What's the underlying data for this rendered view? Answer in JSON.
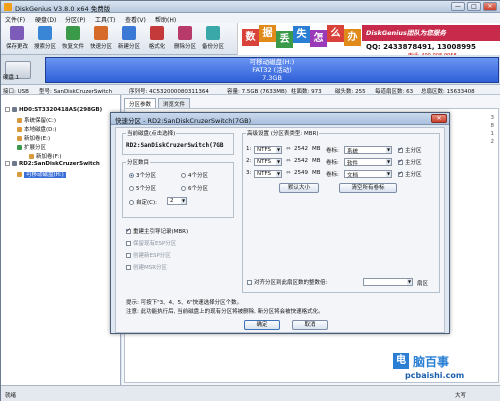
{
  "window": {
    "title": "DiskGenius V3.8.0 x64 免费版",
    "buttons": [
      "—",
      "□",
      "✕"
    ]
  },
  "menu": [
    "文件(F)",
    "硬盘(D)",
    "分区(P)",
    "工具(T)",
    "查看(V)",
    "帮助(H)"
  ],
  "toolbar": [
    {
      "label": "保存更改",
      "icon": "save-icon",
      "color": "#7c5cb8"
    },
    {
      "label": "搜索分区",
      "icon": "search-partition-icon",
      "color": "#3a86d6"
    },
    {
      "label": "恢复文件",
      "icon": "recover-file-icon",
      "color": "#3a9a4a"
    },
    {
      "label": "快速分区",
      "icon": "quick-partition-icon",
      "color": "#d66a2a"
    },
    {
      "label": "新建分区",
      "icon": "new-partition-icon",
      "color": "#3a7ad6"
    },
    {
      "label": "格式化",
      "icon": "format-icon",
      "color": "#c43a3a"
    },
    {
      "label": "删除分区",
      "icon": "delete-partition-icon",
      "color": "#b83a6a"
    },
    {
      "label": "备份分区",
      "icon": "backup-partition-icon",
      "color": "#3aa8a8"
    }
  ],
  "banner": {
    "chars": [
      {
        "ch": "数",
        "color": "#d8423a"
      },
      {
        "ch": "据",
        "color": "#e08a1a"
      },
      {
        "ch": "丢",
        "color": "#3a9a4a"
      },
      {
        "ch": "失",
        "color": "#2a7fd4"
      },
      {
        "ch": "怎",
        "color": "#9a3ab8"
      },
      {
        "ch": "么",
        "color": "#d8423a"
      },
      {
        "ch": "办",
        "color": "#e08a1a"
      }
    ],
    "brand": "DiskGenius团队为您服务",
    "qq": "QQ: 2433878491, 13008995",
    "tel": "电话: 400-008-9958"
  },
  "disk_bar": {
    "disk_label": "硬盘 1",
    "partition_name": "可移动磁盘(H:)",
    "partition_fs": "FAT32 (活动)",
    "partition_size": "7.3GB"
  },
  "info_bar": {
    "interface": "接口: USB",
    "model": "型号: SanDiskCruzerSwitch",
    "serial": "序列号: 4C532000080311364",
    "capacity": "容量: 7.5GB (7633MB)",
    "cylinders": "柱面数: 973",
    "heads": "磁头数: 255",
    "sectors": "每道扇区数: 63",
    "total_sectors": "总扇区数: 15633408"
  },
  "tree": [
    {
      "label": "HD0:ST3320418AS(298GB)",
      "indent": 0,
      "color": "#6c7a8c",
      "selected": false
    },
    {
      "label": "系统保留(C:)",
      "indent": 1,
      "color": "#d89a3a",
      "selected": false
    },
    {
      "label": "本地磁盘(D:)",
      "indent": 1,
      "color": "#d89a3a",
      "selected": false
    },
    {
      "label": "新加卷(E:)",
      "indent": 1,
      "color": "#d89a3a",
      "selected": false
    },
    {
      "label": "扩展分区",
      "indent": 1,
      "color": "#3a9a4a",
      "selected": false
    },
    {
      "label": "新加卷(F:)",
      "indent": 2,
      "color": "#d89a3a",
      "selected": false
    },
    {
      "label": "RD2:SanDiskCruzerSwitch",
      "indent": 0,
      "color": "#6c7a8c",
      "selected": false
    },
    {
      "label": "可移动磁盘(H:)",
      "indent": 1,
      "color": "#d89a3a",
      "selected": true
    }
  ],
  "tabs": [
    "分区参数",
    "浏览文件"
  ],
  "dialog": {
    "title": "快速分区 - RD2:SanDiskCruzerSwitch(7GB)",
    "current_disk_label": "当前磁盘(点击选择)",
    "current_disk": "RD2:SanDiskCruzerSwitch(7GB",
    "count_group_label": "分区数目",
    "counts": [
      {
        "label": "3个分区",
        "selected": true
      },
      {
        "label": "4个分区",
        "selected": false
      },
      {
        "label": "5个分区",
        "selected": false
      },
      {
        "label": "6个分区",
        "selected": false
      },
      {
        "label": "自定(C):",
        "selected": false
      }
    ],
    "custom_value": "2",
    "options": [
      {
        "label": "重建主引导记录(MBR)",
        "checked": true,
        "disabled": false
      },
      {
        "label": "保留现有ESP分区",
        "checked": false,
        "disabled": true
      },
      {
        "label": "创建新ESP分区",
        "checked": false,
        "disabled": true
      },
      {
        "label": "创建MSR分区",
        "checked": false,
        "disabled": true
      }
    ],
    "advanced_label": "高级设置 (分区表类型: MBR)",
    "partitions": [
      {
        "num": "1:",
        "fs": "NTFS",
        "size": "2542",
        "unit": "MB",
        "label_txt": "卷标:",
        "vol": "系统",
        "primary": "主分区",
        "primary_checked": true
      },
      {
        "num": "2:",
        "fs": "NTFS",
        "size": "2542",
        "unit": "MB",
        "label_txt": "卷标:",
        "vol": "软件",
        "primary": "主分区",
        "primary_checked": true
      },
      {
        "num": "3:",
        "fs": "NTFS",
        "size": "2549",
        "unit": "MB",
        "label_txt": "卷标:",
        "vol": "文档",
        "primary": "主分区",
        "primary_checked": true
      }
    ],
    "default_size_btn": "默认大小",
    "clear_labels_btn": "清空所有卷标",
    "align_label": "对齐分区到此扇区数的整数倍:",
    "align_unit": "扇区",
    "tips": [
      "提示: 可按下\"3、4、5、6\"快速选择分区个数。",
      "注意: 此功能执行后, 当前磁盘上的现有分区将被删除, 新分区将会被快速格式化。"
    ],
    "ok": "确定",
    "cancel": "取消"
  },
  "right_ghost": [
    "3",
    "8",
    "1",
    "2"
  ],
  "status": {
    "text": "就绪",
    "caps": "大写"
  },
  "watermark": {
    "char": "电",
    "name": "脑百事",
    "url": "pcbaishi.com"
  }
}
